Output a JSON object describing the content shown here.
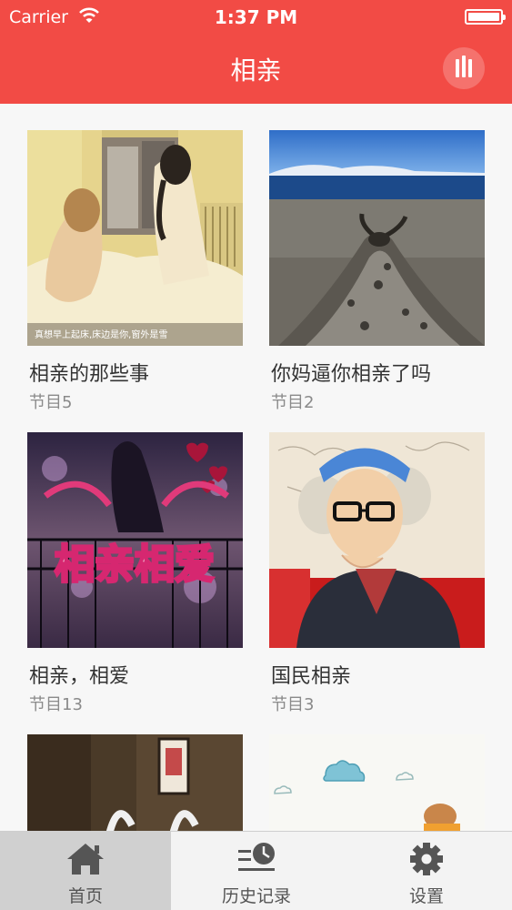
{
  "status_bar": {
    "carrier": "Carrier",
    "time": "1:37 PM"
  },
  "nav": {
    "title": "相亲",
    "play_icon": "now-playing-bars-icon"
  },
  "programs": [
    {
      "title": "相亲的那些事",
      "subtitle": "节目5",
      "caption": "真想早上起床,床边是你,窗外是雪"
    },
    {
      "title": "你妈逼你相亲了吗",
      "subtitle": "节目2"
    },
    {
      "title": "相亲，相爱",
      "subtitle": "节目13",
      "art_text": "相亲相爱"
    },
    {
      "title": "国民相亲",
      "subtitle": "节目3"
    },
    {
      "title": "",
      "subtitle": ""
    },
    {
      "title": "",
      "subtitle": ""
    }
  ],
  "tabs": [
    {
      "label": "首页",
      "icon": "home-icon",
      "active": true
    },
    {
      "label": "历史记录",
      "icon": "history-icon",
      "active": false
    },
    {
      "label": "设置",
      "icon": "gear-icon",
      "active": false
    }
  ],
  "colors": {
    "accent": "#f24b45",
    "tab_active_bg": "#d0d0d0"
  }
}
